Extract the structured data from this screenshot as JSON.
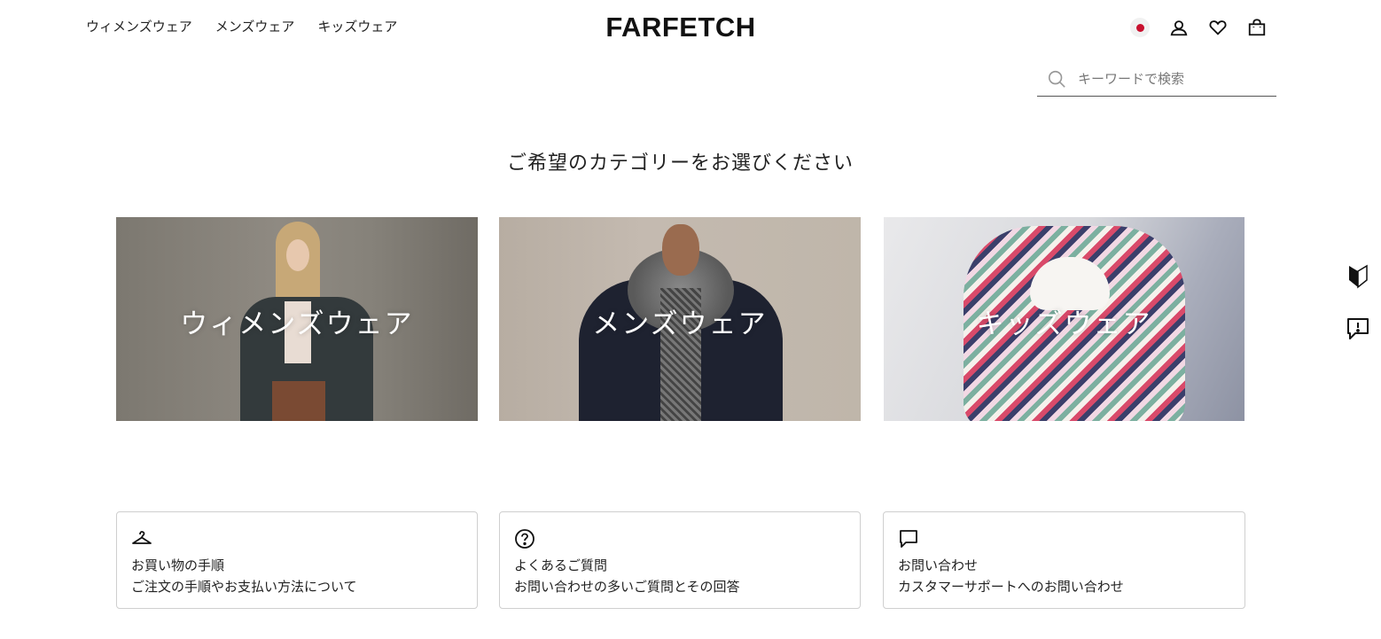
{
  "header": {
    "nav": [
      {
        "label": "ウィメンズウェア"
      },
      {
        "label": "メンズウェア"
      },
      {
        "label": "キッズウェア"
      }
    ],
    "logo": "FARFETCH",
    "icons": [
      "japan-flag-icon",
      "account-icon",
      "heart-icon",
      "shopping-bag-icon"
    ]
  },
  "search": {
    "placeholder": "キーワードで検索",
    "value": ""
  },
  "main": {
    "heading": "ご希望のカテゴリーをお選びください",
    "categories": [
      {
        "label": "ウィメンズウェア"
      },
      {
        "label": "メンズウェア"
      },
      {
        "label": "キッズウェア"
      }
    ]
  },
  "help": [
    {
      "icon": "hanger-icon",
      "title": "お買い物の手順",
      "desc": "ご注文の手順やお支払い方法について"
    },
    {
      "icon": "question-icon",
      "title": "よくあるご質問",
      "desc": "お問い合わせの多いご質問とその回答"
    },
    {
      "icon": "chat-icon",
      "title": "お問い合わせ",
      "desc": "カスタマーサポートへのお問い合わせ"
    }
  ],
  "side": {
    "icons": [
      "beginner-mark-icon",
      "feedback-icon"
    ]
  },
  "colors": {
    "text": "#222222",
    "border": "#cfcfcf",
    "flag_red": "#c8102e"
  }
}
